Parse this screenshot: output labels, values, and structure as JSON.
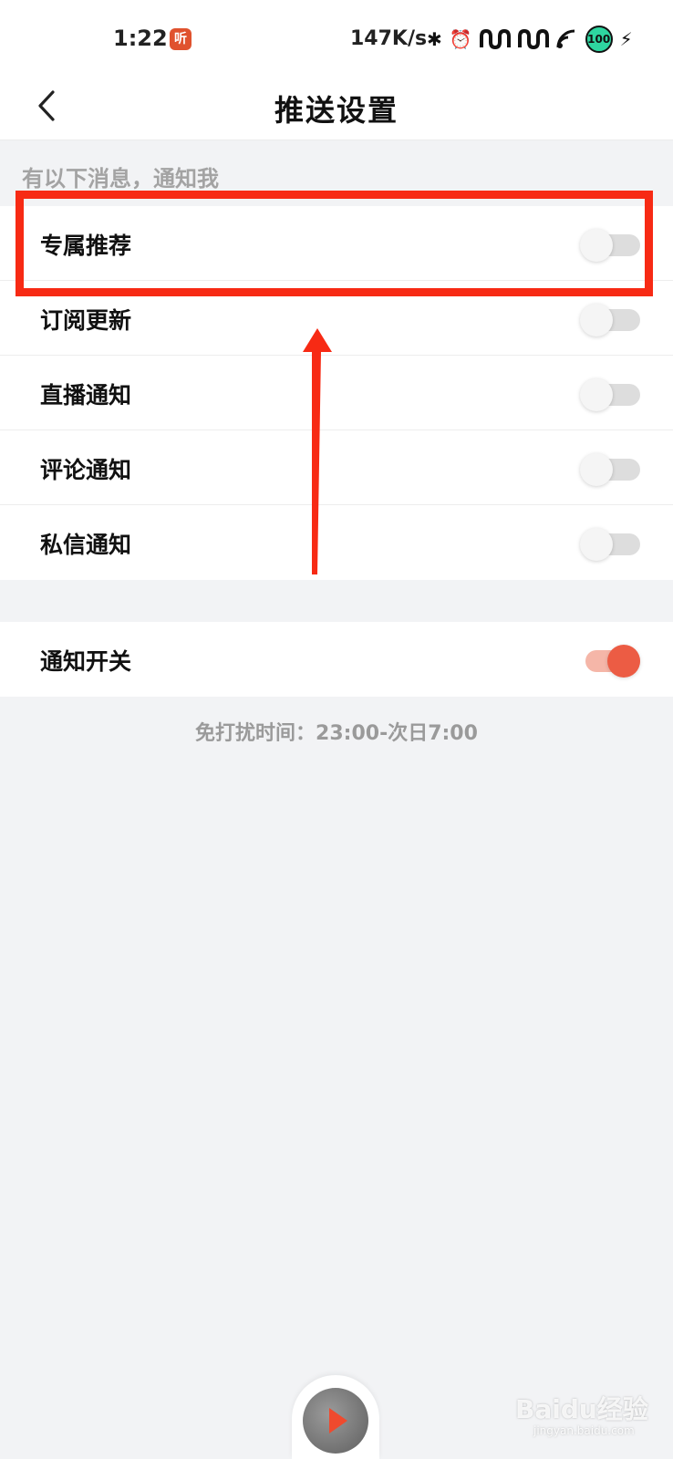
{
  "status_bar": {
    "time": "1:22",
    "app_icon_text": "听",
    "net_speed": "147K/s",
    "battery": "100",
    "icons": [
      "bluetooth-icon",
      "alarm-icon",
      "signal-icon",
      "signal-icon",
      "wifi-icon",
      "battery-icon",
      "charging-icon"
    ]
  },
  "header": {
    "title": "推送设置",
    "back_icon": "chevron-left-icon"
  },
  "section_label": "有以下消息，通知我",
  "notifications": [
    {
      "label": "专属推荐",
      "enabled": false
    },
    {
      "label": "订阅更新",
      "enabled": false
    },
    {
      "label": "直播通知",
      "enabled": false
    },
    {
      "label": "评论通知",
      "enabled": false
    },
    {
      "label": "私信通知",
      "enabled": false
    }
  ],
  "master_switch": {
    "label": "通知开关",
    "enabled": true
  },
  "dnd_text": "免打扰时间：23:00-次日7:00",
  "annotation": {
    "color": "#f72a14"
  },
  "player": {
    "play_icon": "play-icon"
  },
  "watermark": {
    "text": "Baidu经验",
    "sub": "jingyan.baidu.com"
  },
  "colors": {
    "accent": "#ec5c44",
    "background": "#f2f3f5"
  }
}
